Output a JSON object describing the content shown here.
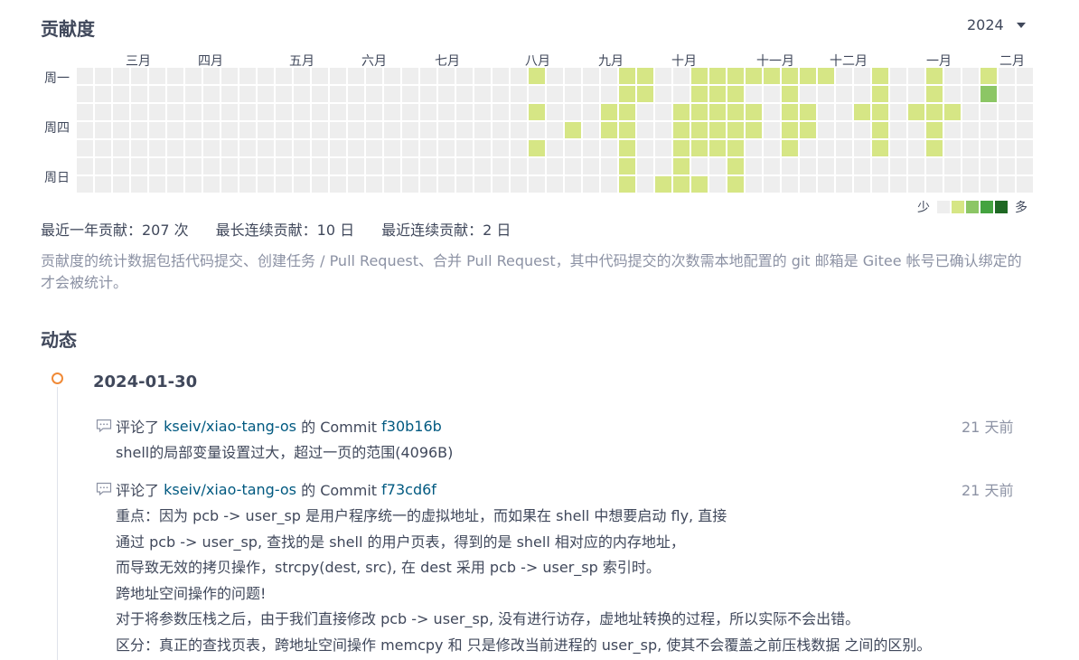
{
  "contribution": {
    "title": "贡献度",
    "year": "2024",
    "months": [
      "三月",
      "四月",
      "五月",
      "六月",
      "七月",
      "八月",
      "九月",
      "十月",
      "十一月",
      "十二月",
      "一月",
      "二月"
    ],
    "weekdays": [
      "周一",
      "周四",
      "周日"
    ],
    "legend": {
      "few": "少",
      "many": "多"
    },
    "colors": [
      "#eeeeee",
      "#d6e685",
      "#8cc665",
      "#44a340",
      "#1e6823"
    ],
    "stats": {
      "yearly": "最近一年贡献：207 次",
      "longest": "最长连续贡献：10 日",
      "recent": "最近连续贡献：2 日"
    },
    "note": "贡献度的统计数据包括代码提交、创建任务 / Pull Request、合并 Pull Request，其中代码提交的次数需本地配置的 git 邮箱是 Gitee 帐号已确认绑定的才会被统计。",
    "levels": [
      [
        0,
        0,
        0,
        0,
        0,
        0,
        0
      ],
      [
        0,
        0,
        0,
        0,
        0,
        0,
        0
      ],
      [
        0,
        0,
        0,
        0,
        0,
        0,
        0
      ],
      [
        0,
        0,
        0,
        0,
        0,
        0,
        0
      ],
      [
        0,
        0,
        0,
        0,
        0,
        0,
        0
      ],
      [
        0,
        0,
        0,
        0,
        0,
        0,
        0
      ],
      [
        0,
        0,
        0,
        0,
        0,
        0,
        0
      ],
      [
        0,
        0,
        0,
        0,
        0,
        0,
        0
      ],
      [
        0,
        0,
        0,
        0,
        0,
        0,
        0
      ],
      [
        0,
        0,
        0,
        0,
        0,
        0,
        0
      ],
      [
        0,
        0,
        0,
        0,
        0,
        0,
        0
      ],
      [
        0,
        0,
        0,
        0,
        0,
        0,
        0
      ],
      [
        0,
        0,
        0,
        0,
        0,
        0,
        0
      ],
      [
        0,
        0,
        0,
        0,
        0,
        0,
        0
      ],
      [
        0,
        0,
        0,
        0,
        0,
        0,
        0
      ],
      [
        0,
        0,
        0,
        0,
        0,
        0,
        0
      ],
      [
        0,
        0,
        0,
        0,
        0,
        0,
        0
      ],
      [
        0,
        0,
        0,
        0,
        0,
        0,
        0
      ],
      [
        0,
        0,
        0,
        0,
        0,
        0,
        0
      ],
      [
        0,
        0,
        0,
        0,
        0,
        0,
        0
      ],
      [
        0,
        0,
        0,
        0,
        0,
        0,
        0
      ],
      [
        0,
        0,
        0,
        0,
        0,
        0,
        0
      ],
      [
        0,
        0,
        0,
        0,
        0,
        0,
        0
      ],
      [
        0,
        0,
        0,
        0,
        0,
        0,
        0
      ],
      [
        0,
        0,
        0,
        0,
        0,
        0,
        0
      ],
      [
        1,
        0,
        1,
        0,
        1,
        0,
        0
      ],
      [
        0,
        0,
        0,
        0,
        0,
        0,
        0
      ],
      [
        0,
        0,
        0,
        1,
        0,
        0,
        0
      ],
      [
        0,
        0,
        0,
        0,
        0,
        0,
        0
      ],
      [
        0,
        0,
        1,
        1,
        0,
        0,
        0
      ],
      [
        1,
        1,
        1,
        1,
        1,
        1,
        1
      ],
      [
        1,
        1,
        0,
        0,
        0,
        0,
        0
      ],
      [
        0,
        0,
        0,
        0,
        0,
        0,
        1
      ],
      [
        0,
        0,
        1,
        1,
        1,
        1,
        1
      ],
      [
        1,
        1,
        1,
        1,
        1,
        0,
        1
      ],
      [
        1,
        1,
        1,
        1,
        1,
        0,
        0
      ],
      [
        1,
        1,
        1,
        1,
        1,
        1,
        1
      ],
      [
        1,
        0,
        1,
        1,
        0,
        0,
        0
      ],
      [
        1,
        0,
        0,
        0,
        0,
        0,
        0
      ],
      [
        1,
        1,
        1,
        1,
        1,
        0,
        0
      ],
      [
        1,
        0,
        1,
        1,
        0,
        0,
        0
      ],
      [
        1,
        0,
        0,
        0,
        0,
        0,
        0
      ],
      [
        0,
        0,
        0,
        0,
        0,
        0,
        0
      ],
      [
        0,
        0,
        1,
        0,
        0,
        0,
        0
      ],
      [
        1,
        1,
        1,
        1,
        1,
        0,
        0
      ],
      [
        0,
        0,
        0,
        0,
        0,
        0,
        0
      ],
      [
        0,
        0,
        1,
        0,
        0,
        0,
        0
      ],
      [
        1,
        1,
        1,
        1,
        1,
        0,
        0
      ],
      [
        0,
        0,
        1,
        0,
        0,
        0,
        0
      ],
      [
        0,
        0,
        0,
        0,
        0,
        0,
        0
      ],
      [
        1,
        2,
        0,
        0,
        0,
        0,
        0
      ],
      [
        0,
        0,
        0,
        0,
        0,
        0,
        0
      ],
      [
        0,
        0,
        0,
        0,
        0,
        0,
        0
      ]
    ]
  },
  "activity": {
    "title": "动态",
    "date": "2024-01-30",
    "events": [
      {
        "action": "评论了",
        "repo": "kseiv/xiao-tang-os",
        "of": "的 Commit",
        "commit": "f30b16b",
        "time": "21 天前",
        "body": [
          "shell的局部变量设置过大，超过一页的范围(4096B)"
        ]
      },
      {
        "action": "评论了",
        "repo": "kseiv/xiao-tang-os",
        "of": "的 Commit",
        "commit": "f73cd6f",
        "time": "21 天前",
        "body": [
          "重点：因为 pcb -> user_sp 是用户程序统一的虚拟地址，而如果在 shell 中想要启动 fly, 直接",
          "通过 pcb -> user_sp, 查找的是 shell 的用户页表，得到的是 shell 相对应的内存地址，",
          "而导致无效的拷贝操作，strcpy(dest, src), 在 dest 采用 pcb -> user_sp 索引时。",
          "跨地址空间操作的问题!",
          "对于将参数压栈之后，由于我们直接修改 pcb -> user_sp, 没有进行访存，虚地址转换的过程，所以实际不会出错。",
          "区分：真正的查找页表，跨地址空间操作 memcpy 和 只是修改当前进程的 user_sp, 使其不会覆盖之前压栈数据 之间的区别。"
        ]
      }
    ]
  }
}
